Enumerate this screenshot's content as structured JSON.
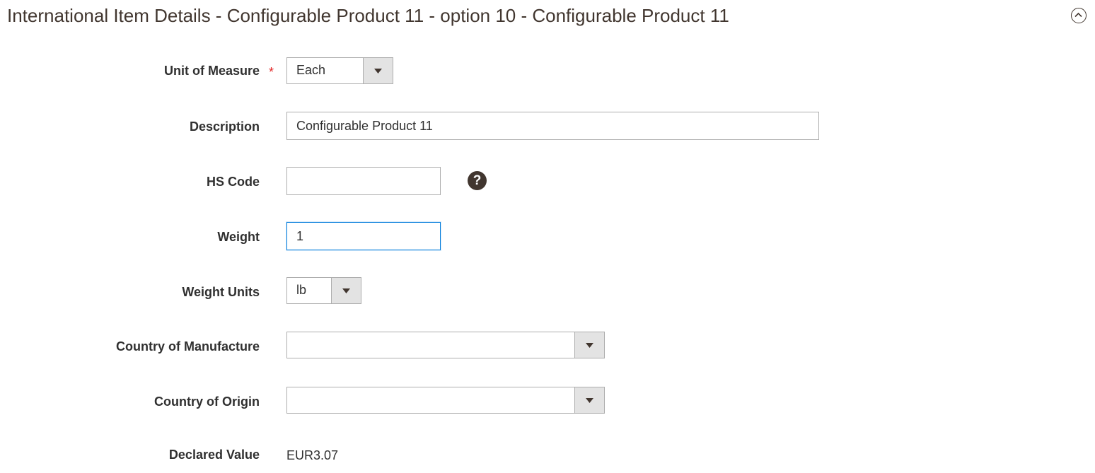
{
  "section": {
    "title": "International Item Details - Configurable Product 11 - option 10 - Configurable Product 11",
    "toggle_icon": "chevron-up-circle-icon"
  },
  "form": {
    "unit_of_measure": {
      "label": "Unit of Measure",
      "required_mark": "*",
      "value": "Each"
    },
    "description": {
      "label": "Description",
      "value": "Configurable Product 11"
    },
    "hs_code": {
      "label": "HS Code",
      "value": "",
      "help_icon": "question-mark-icon",
      "help_glyph": "?"
    },
    "weight": {
      "label": "Weight",
      "value": "1"
    },
    "weight_units": {
      "label": "Weight Units",
      "value": "lb"
    },
    "country_of_manufacture": {
      "label": "Country of Manufacture",
      "value": ""
    },
    "country_of_origin": {
      "label": "Country of Origin",
      "value": ""
    },
    "declared_value": {
      "label": "Declared Value",
      "value": "EUR3.07"
    }
  },
  "colors": {
    "title_text": "#41362f",
    "required_star": "#e22626",
    "focus_border": "#007bdb",
    "field_border": "#adadad",
    "select_arrow_bg": "#e3e3e3"
  }
}
